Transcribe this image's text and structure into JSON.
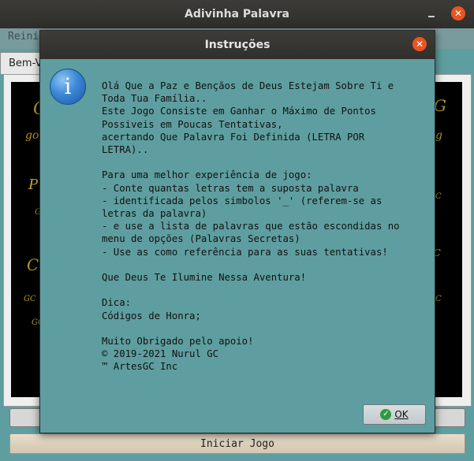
{
  "main_window": {
    "title": "Adivinha Palavra",
    "menu_item": "Reini",
    "tab_label": "Bem-V",
    "start_button_label": "Iniciar Jogo"
  },
  "dialog": {
    "title": "Instruções",
    "icon": "info-icon",
    "ok_label": "OK",
    "lines": [
      "Olá Que a Paz e Bençãos de Deus Estejam Sobre Ti e",
      "Toda Tua Família..",
      "Este Jogo Consiste em Ganhar o Máximo de Pontos",
      "Possiveis em Poucas Tentativas,",
      "acertando Que Palavra Foi Definida (LETRA POR",
      "LETRA)..",
      "",
      "Para uma melhor experiência de jogo:",
      "- Conte quantas letras tem a suposta palavra",
      "- identificada pelos simbolos '_' (referem-se as",
      "letras da palavra)",
      "- e use a lista de palavras que estão escondidas no",
      "menu de opções (Palavras Secretas)",
      "- Use as como referência para as suas tentativas!",
      "",
      "Que Deus Te Ilumine Nessa Aventura!",
      "",
      "Dica:",
      "Códigos de Honra;",
      "",
      "Muito Obrigado pelo apoio!",
      "© 2019-2021 Nurul GC",
      "™ ArtesGC Inc"
    ]
  },
  "colors": {
    "dialog_bg": "#5f9ea0",
    "titlebar": "#3c3b37",
    "close": "#e95420",
    "gold": "#b59a2b"
  }
}
